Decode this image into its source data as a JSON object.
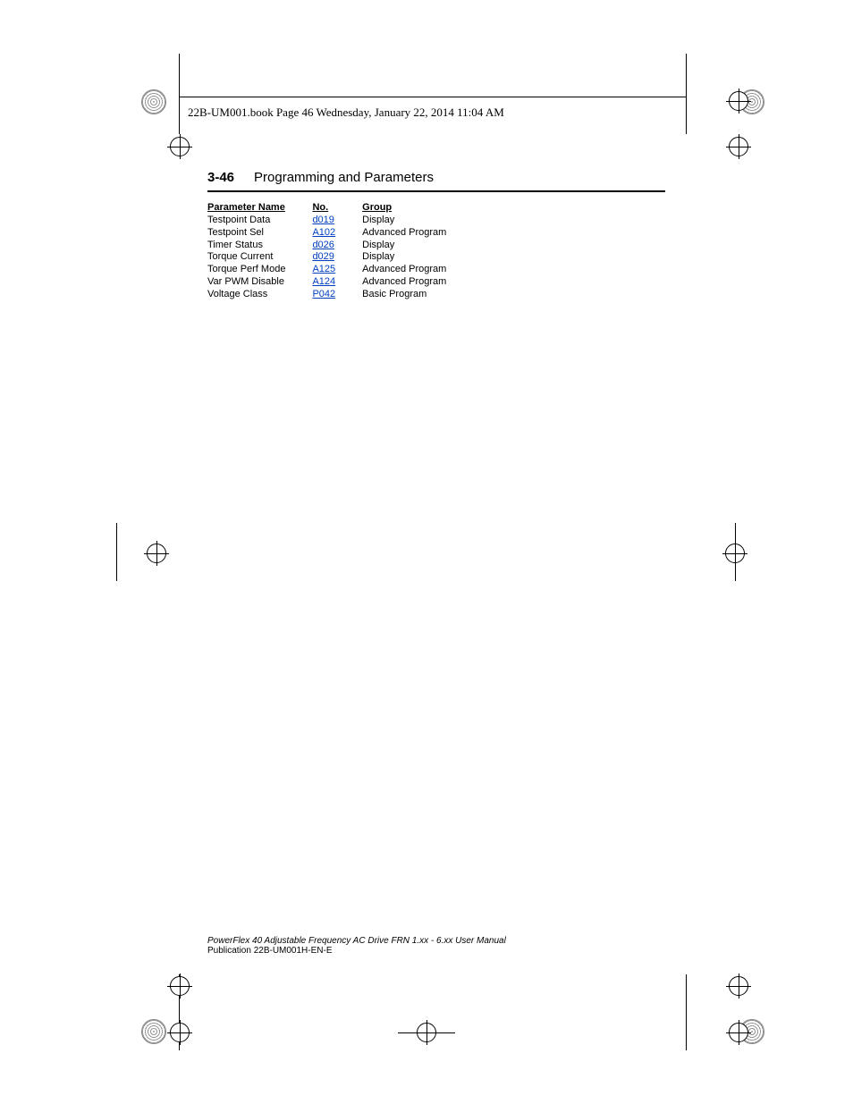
{
  "book_line": "22B-UM001.book  Page 46  Wednesday, January 22, 2014  11:04 AM",
  "page_number": "3-46",
  "chapter_title": "Programming and Parameters",
  "table": {
    "headers": {
      "name": "Parameter Name",
      "no": "No.",
      "group": "Group"
    },
    "rows": [
      {
        "name": "Testpoint Data",
        "no": "d019",
        "group": "Display"
      },
      {
        "name": "Testpoint Sel",
        "no": "A102",
        "group": "Advanced Program"
      },
      {
        "name": "Timer Status",
        "no": "d026",
        "group": "Display"
      },
      {
        "name": "Torque Current",
        "no": "d029",
        "group": "Display"
      },
      {
        "name": "Torque Perf Mode",
        "no": "A125",
        "group": "Advanced Program"
      },
      {
        "name": "Var PWM Disable",
        "no": "A124",
        "group": "Advanced Program"
      },
      {
        "name": "Voltage Class",
        "no": "P042",
        "group": "Basic Program"
      }
    ]
  },
  "footer": {
    "title": "PowerFlex 40 Adjustable Frequency AC Drive FRN 1.xx - 6.xx User Manual",
    "pub": "Publication 22B-UM001H-EN-E"
  }
}
